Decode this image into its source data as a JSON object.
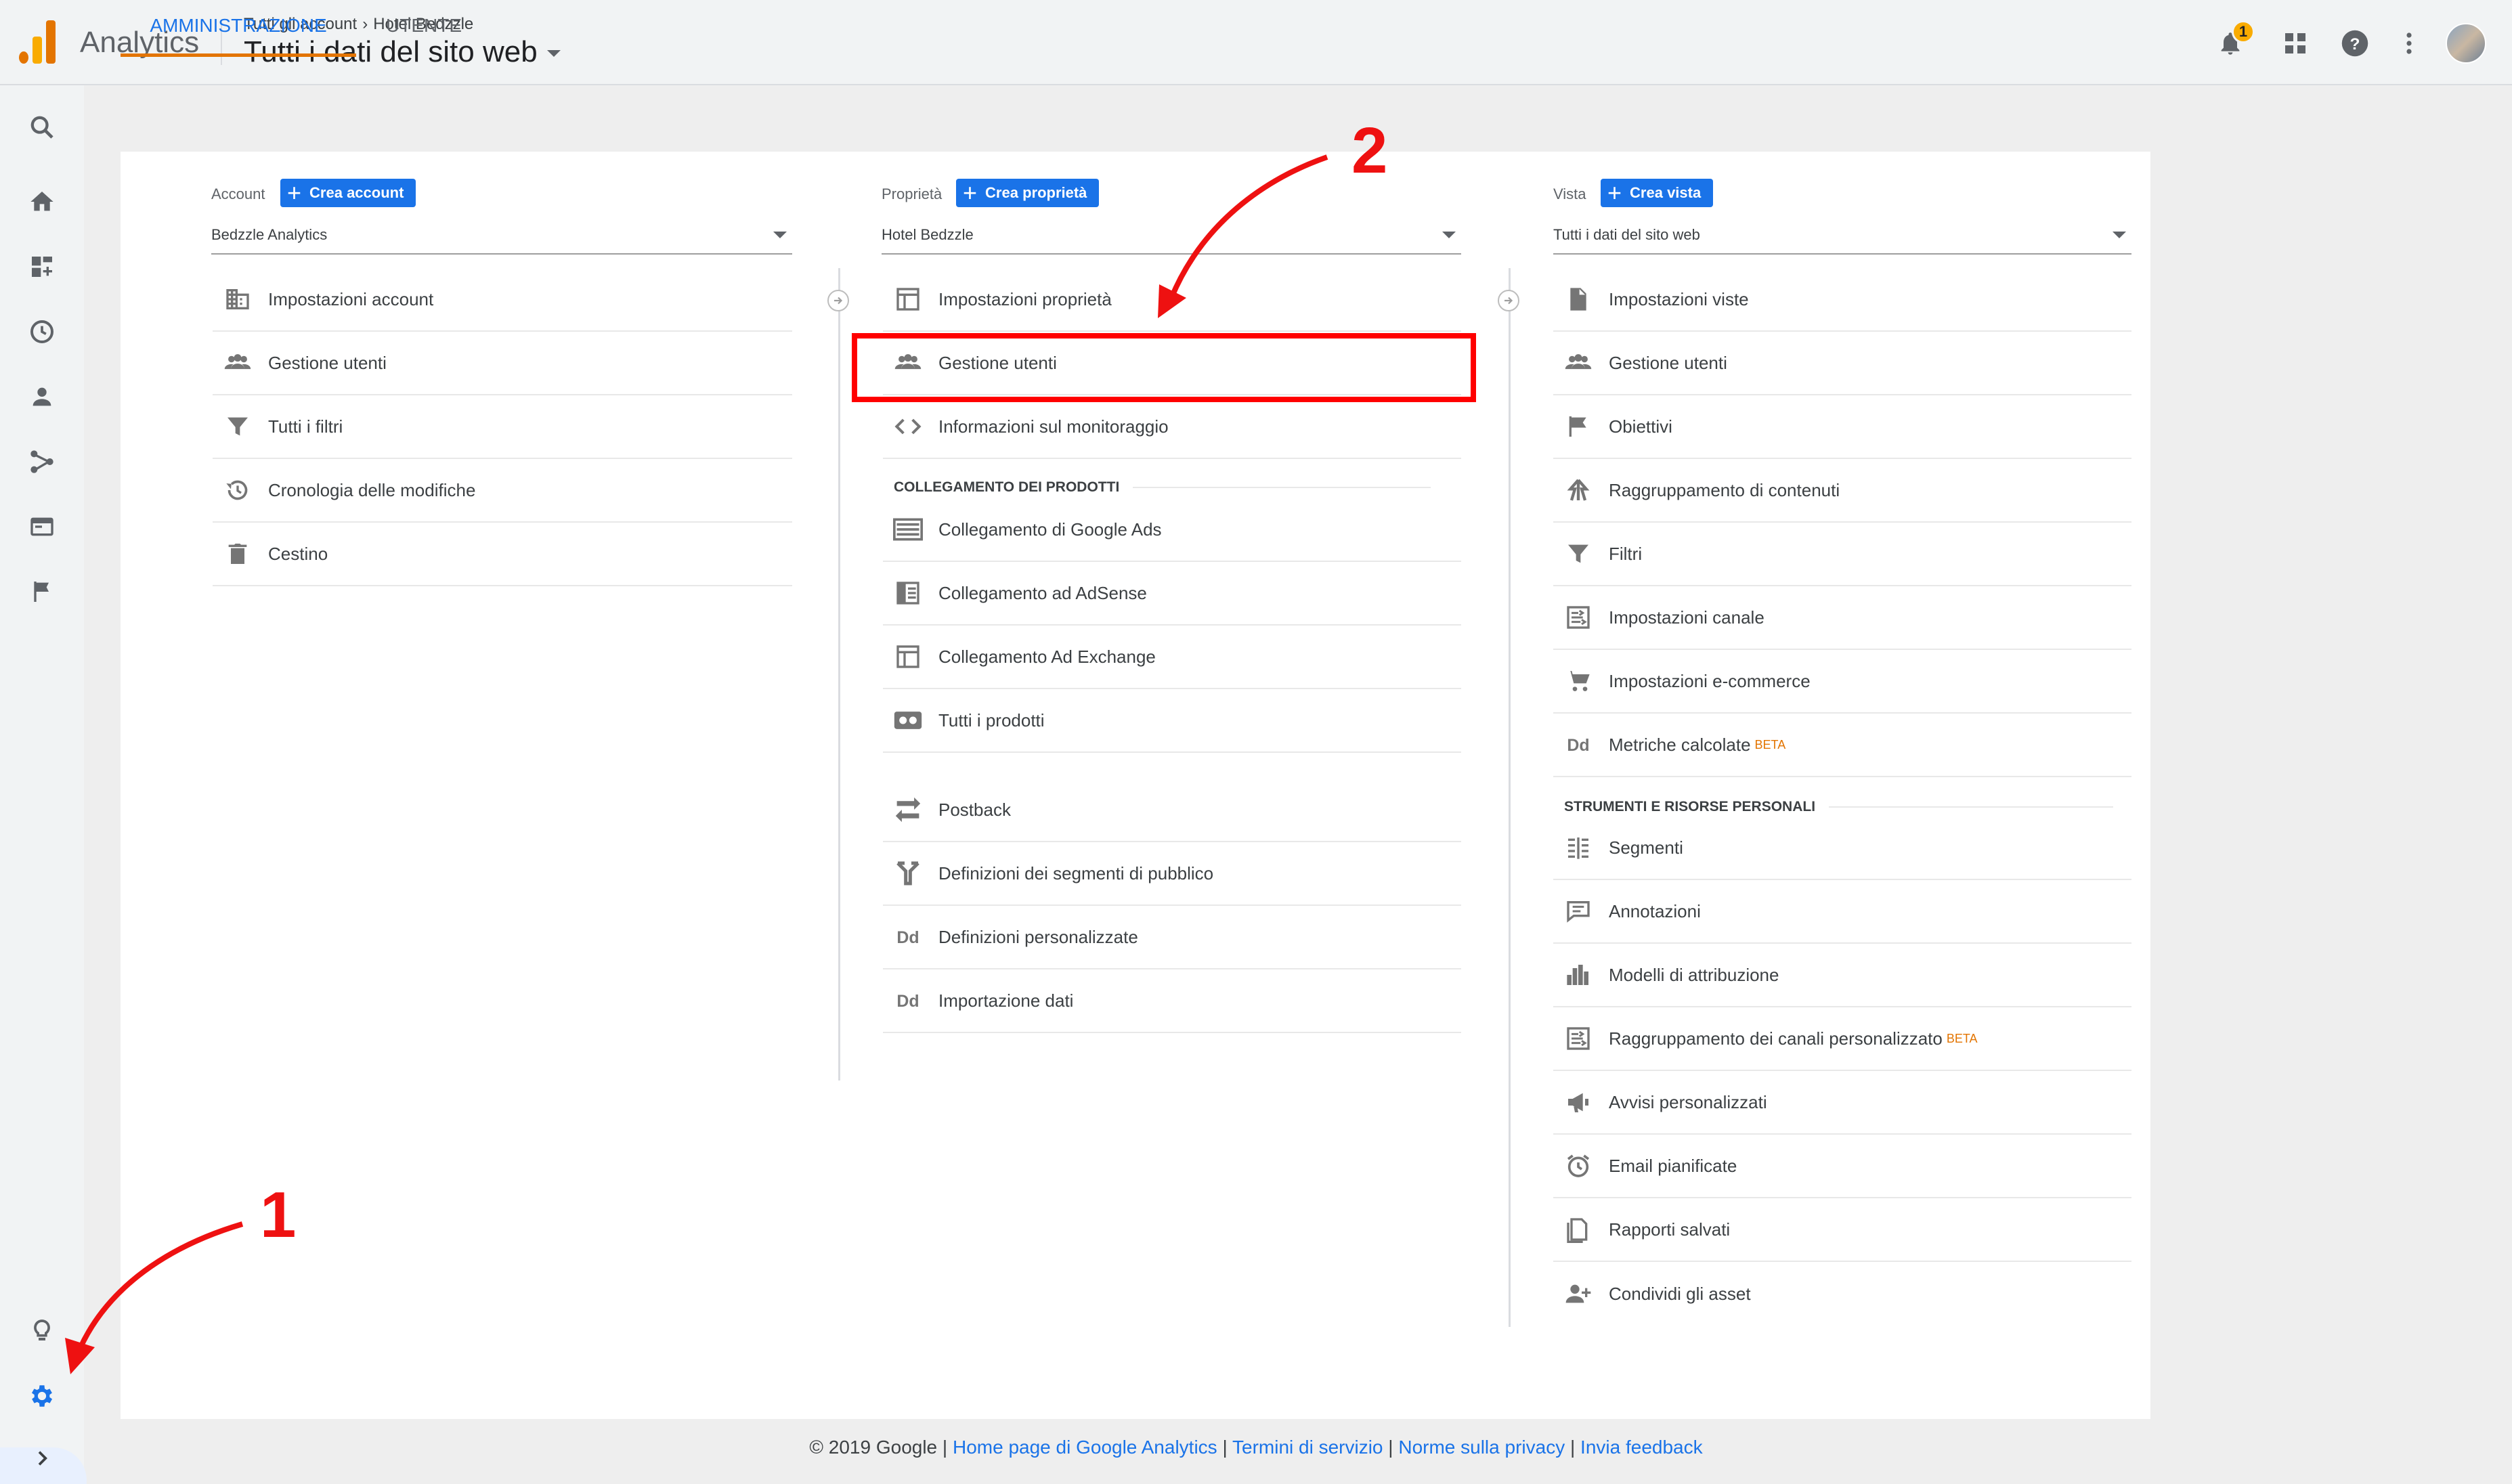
{
  "header": {
    "app_title": "Analytics",
    "breadcrumb_account": "Tutti gli account",
    "breadcrumb_property": "Hotel Bedzzle",
    "view_title": "Tutti i dati del sito web",
    "notification_count": "1"
  },
  "tabs": [
    {
      "label": "AMMINISTRAZIONE",
      "active": true
    },
    {
      "label": "UTENTE",
      "active": false
    }
  ],
  "account": {
    "header": "Account",
    "create_label": "Crea account",
    "selected": "Bedzzle Analytics",
    "items": [
      {
        "label": "Impostazioni account",
        "icon": "building-icon"
      },
      {
        "label": "Gestione utenti",
        "icon": "people-icon"
      },
      {
        "label": "Tutti i filtri",
        "icon": "filter-icon"
      },
      {
        "label": "Cronologia delle modifiche",
        "icon": "history-icon"
      },
      {
        "label": "Cestino",
        "icon": "trash-icon"
      }
    ]
  },
  "property": {
    "header": "Proprietà",
    "create_label": "Crea proprietà",
    "selected": "Hotel Bedzzle",
    "items": [
      {
        "label": "Impostazioni proprietà",
        "icon": "property-settings-icon"
      },
      {
        "label": "Gestione utenti",
        "icon": "people-icon"
      },
      {
        "label": "Informazioni sul monitoraggio",
        "icon": "code-icon"
      }
    ],
    "section_title": "COLLEGAMENTO DEI PRODOTTI",
    "product_items": [
      {
        "label": "Collegamento di Google Ads",
        "icon": "ads-icon"
      },
      {
        "label": "Collegamento ad AdSense",
        "icon": "adsense-icon"
      },
      {
        "label": "Collegamento Ad Exchange",
        "icon": "adexchange-icon"
      },
      {
        "label": "Tutti i prodotti",
        "icon": "products-icon"
      }
    ],
    "more_items": [
      {
        "label": "Postback",
        "icon": "postback-icon"
      },
      {
        "label": "Definizioni dei segmenti di pubblico",
        "icon": "audience-icon"
      },
      {
        "label": "Definizioni personalizzate",
        "icon": "dd-icon"
      },
      {
        "label": "Importazione dati",
        "icon": "dd-icon"
      }
    ]
  },
  "view": {
    "header": "Vista",
    "create_label": "Crea vista",
    "selected": "Tutti i dati del sito web",
    "items": [
      {
        "label": "Impostazioni viste",
        "icon": "document-icon"
      },
      {
        "label": "Gestione utenti",
        "icon": "people-icon"
      },
      {
        "label": "Obiettivi",
        "icon": "flag-icon"
      },
      {
        "label": "Raggruppamento di contenuti",
        "icon": "walk-icon"
      },
      {
        "label": "Filtri",
        "icon": "filter-icon"
      },
      {
        "label": "Impostazioni canale",
        "icon": "channel-icon"
      },
      {
        "label": "Impostazioni e-commerce",
        "icon": "cart-icon"
      },
      {
        "label": "Metriche calcolate",
        "icon": "dd-icon",
        "beta": "BETA"
      }
    ],
    "section_title": "STRUMENTI E RISORSE PERSONALI",
    "tool_items": [
      {
        "label": "Segmenti",
        "icon": "segments-icon"
      },
      {
        "label": "Annotazioni",
        "icon": "annotation-icon"
      },
      {
        "label": "Modelli di attribuzione",
        "icon": "bar-chart-icon"
      },
      {
        "label": "Raggruppamento dei canali personalizzato",
        "icon": "channel-icon",
        "beta": "BETA"
      },
      {
        "label": "Avvisi personalizzati",
        "icon": "megaphone-icon"
      },
      {
        "label": "Email pianificate",
        "icon": "alarm-icon"
      },
      {
        "label": "Rapporti salvati",
        "icon": "saved-report-icon"
      },
      {
        "label": "Condividi gli asset",
        "icon": "person-add-icon"
      }
    ]
  },
  "annotations": {
    "step1": "1",
    "step2": "2"
  },
  "footer": {
    "copyright": "© 2019 Google",
    "links": [
      "Home page di Google Analytics",
      "Termini di servizio",
      "Norme sulla privacy",
      "Invia feedback"
    ]
  },
  "colors": {
    "accent": "#1a73e8",
    "brand_orange": "#e37400",
    "annotation_red": "#ff0000"
  }
}
